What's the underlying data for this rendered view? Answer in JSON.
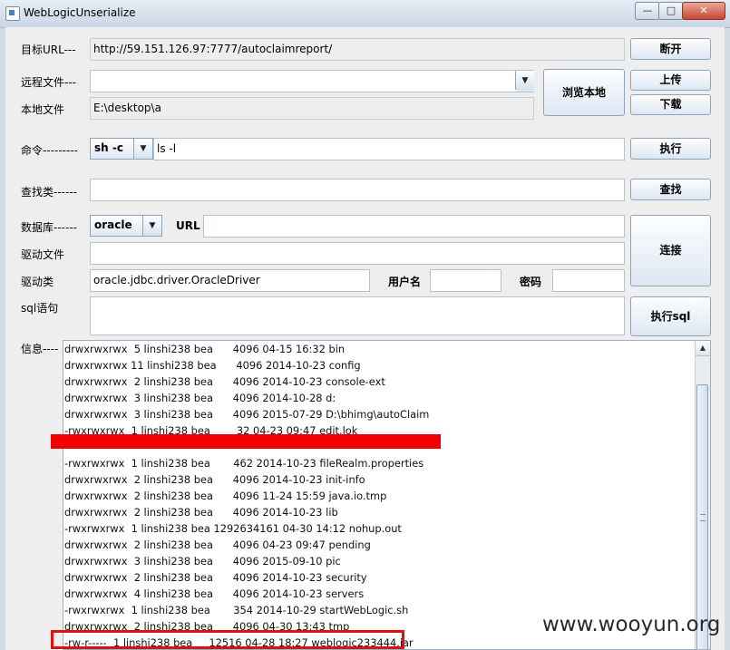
{
  "window": {
    "title": "WebLogicUnserialize",
    "controls": {
      "minimize": "—",
      "maximize": "□",
      "close": "✕"
    }
  },
  "url": {
    "label": "目标URL---",
    "value": "http://59.151.126.97:7777/autoclaimreport/",
    "button": "断开"
  },
  "remote_file": {
    "label": "远程文件---",
    "value": "",
    "upload": "上传",
    "download": "下载",
    "browse": "浏览本地"
  },
  "local_file": {
    "label": "本地文件",
    "value": "E:\\desktop\\a"
  },
  "command": {
    "label": "命令---------",
    "shell": "sh -c",
    "value": "ls -l",
    "button": "执行"
  },
  "find_class": {
    "label": "查找类------",
    "value": "",
    "button": "查找"
  },
  "database": {
    "label": "数据库------",
    "type": "oracle",
    "url_label": "URL",
    "url_value": "",
    "connect": "连接"
  },
  "driver_file": {
    "label": "驱动文件",
    "value": ""
  },
  "driver_class": {
    "label": "驱动类",
    "value": "oracle.jdbc.driver.OracleDriver",
    "user_label": "用户名",
    "user_value": "",
    "pass_label": "密码",
    "pass_value": ""
  },
  "sql": {
    "label": "sql语句",
    "value": "",
    "button": "执行sql"
  },
  "info": {
    "label": "信息----",
    "lines": [
      "drwxrwxrwx  5 linshi238 bea      4096 04-15 16:32 bin",
      "drwxrwxrwx 11 linshi238 bea      4096 2014-10-23 config",
      "drwxrwxrwx  2 linshi238 bea      4096 2014-10-23 console-ext",
      "drwxrwxrwx  3 linshi238 bea      4096 2014-10-28 d:",
      "drwxrwxrwx  3 linshi238 bea      4096 2015-07-29 D:\\bhimg\\autoClaim",
      "-rwxrwxrwx  1 linshi238 bea        32 04-23 09:47 edit.lok",
      "",
      "-rwxrwxrwx  1 linshi238 bea       462 2014-10-23 fileRealm.properties",
      "drwxrwxrwx  2 linshi238 bea      4096 2014-10-23 init-info",
      "drwxrwxrwx  2 linshi238 bea      4096 11-24 15:59 java.io.tmp",
      "drwxrwxrwx  2 linshi238 bea      4096 2014-10-23 lib",
      "-rwxrwxrwx  1 linshi238 bea 1292634161 04-30 14:12 nohup.out",
      "drwxrwxrwx  2 linshi238 bea      4096 04-23 09:47 pending",
      "drwxrwxrwx  3 linshi238 bea      4096 2015-09-10 pic",
      "drwxrwxrwx  2 linshi238 bea      4096 2014-10-23 security",
      "drwxrwxrwx  4 linshi238 bea      4096 2014-10-23 servers",
      "-rwxrwxrwx  1 linshi238 bea       354 2014-10-29 startWebLogic.sh",
      "drwxrwxrwx  2 linshi238 bea      4096 04-30 13:43 tmp",
      "-rw-r-----  1 linshi238 bea     12516 04-28 18:27 weblogic233444.jar"
    ]
  },
  "watermark": "www.wooyun.org",
  "colors": {
    "redaction": "#f00000",
    "highlight_box": "#e01010"
  }
}
